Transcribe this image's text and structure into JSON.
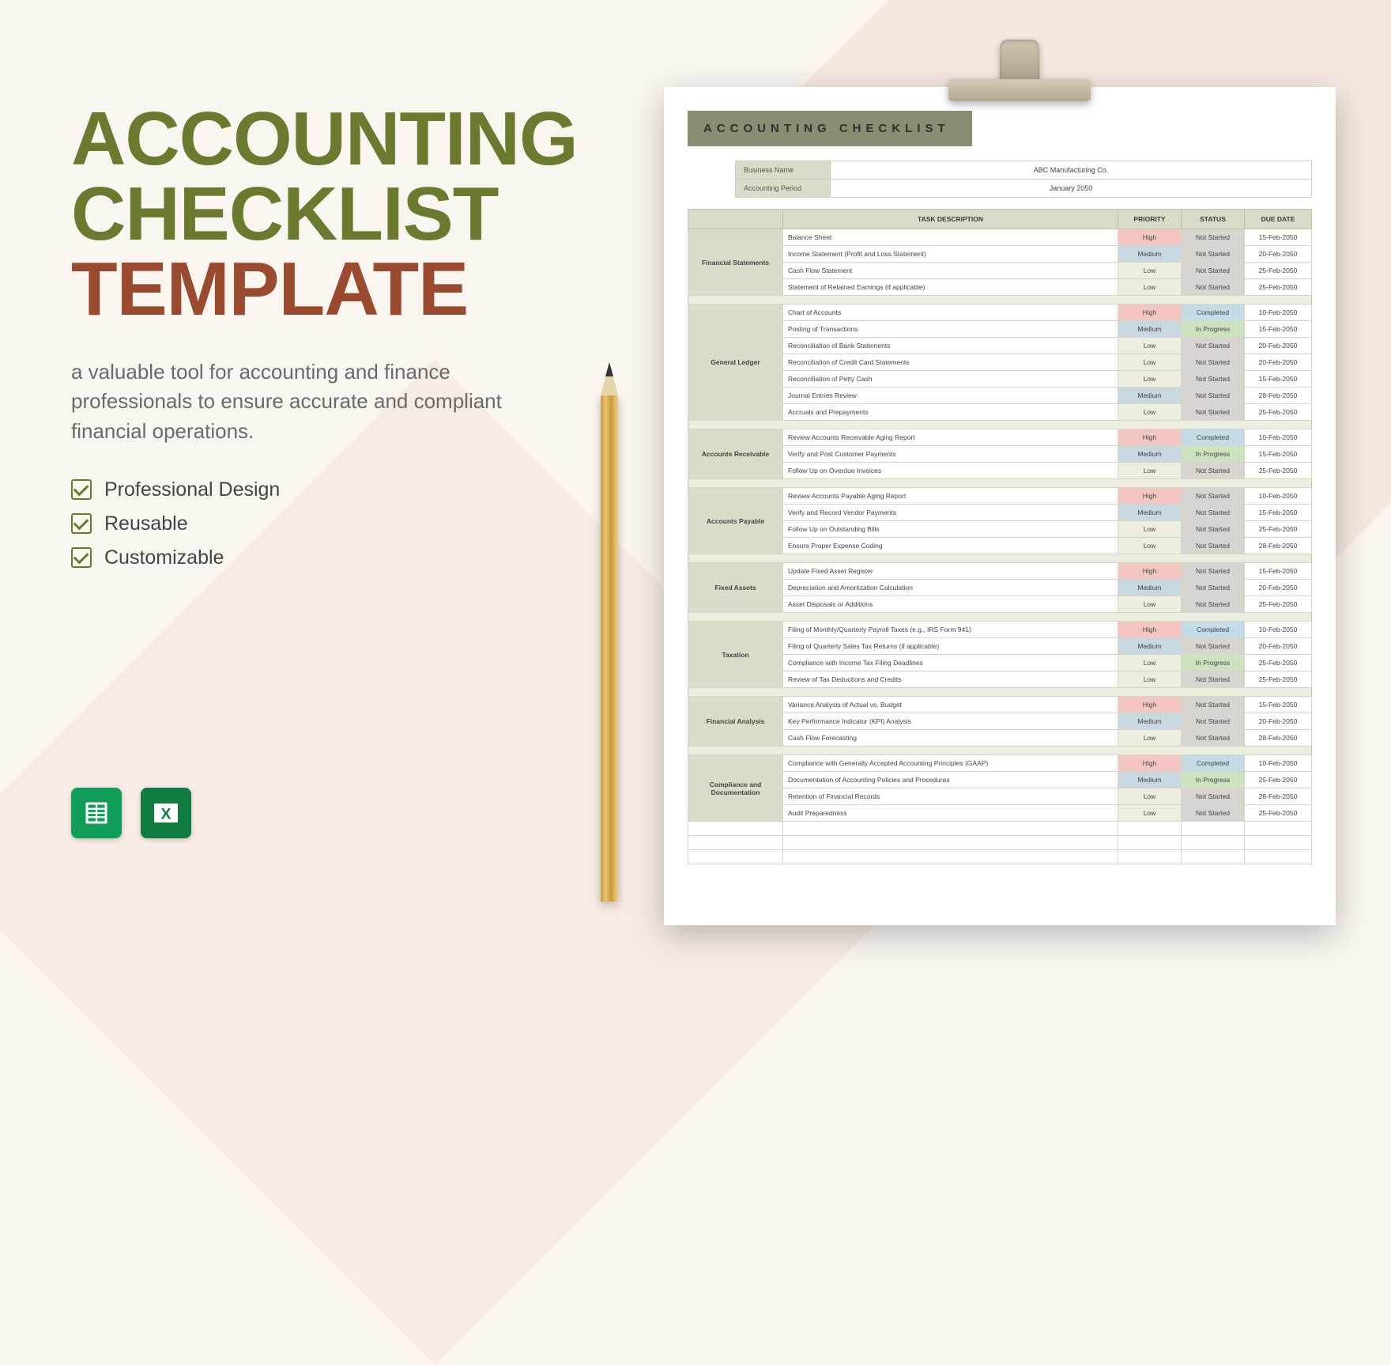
{
  "title": {
    "line1": "ACCOUNTING",
    "line2": "CHECKLIST",
    "line3": "TEMPLATE"
  },
  "description": "a valuable tool for accounting and finance professionals to ensure accurate and compliant financial operations.",
  "features": [
    "Professional Design",
    "Reusable",
    "Customizable"
  ],
  "apps": {
    "sheets": "Google Sheets",
    "excel": "Excel"
  },
  "sheet": {
    "heading": "ACCOUNTING CHECKLIST",
    "meta": [
      {
        "label": "Business Name",
        "value": "ABC Manufacturing Co."
      },
      {
        "label": "Accounting Period",
        "value": "January 2050"
      }
    ],
    "columns": [
      "TASK DESCRIPTION",
      "PRIORITY",
      "STATUS",
      "DUE DATE"
    ],
    "sections": [
      {
        "name": "Financial Statements",
        "rows": [
          {
            "task": "Balance Sheet",
            "priority": "High",
            "status": "Not Started",
            "due": "15-Feb-2050"
          },
          {
            "task": "Income Statement (Profit and Loss Statement)",
            "priority": "Medium",
            "status": "Not Started",
            "due": "20-Feb-2050"
          },
          {
            "task": "Cash Flow Statement",
            "priority": "Low",
            "status": "Not Started",
            "due": "25-Feb-2050"
          },
          {
            "task": "Statement of Retained Earnings (if applicable)",
            "priority": "Low",
            "status": "Not Started",
            "due": "25-Feb-2050"
          }
        ]
      },
      {
        "name": "General Ledger",
        "rows": [
          {
            "task": "Chart of Accounts",
            "priority": "High",
            "status": "Completed",
            "due": "10-Feb-2050"
          },
          {
            "task": "Posting of Transactions",
            "priority": "Medium",
            "status": "In Progress",
            "due": "15-Feb-2050"
          },
          {
            "task": "Reconciliation of Bank Statements",
            "priority": "Low",
            "status": "Not Started",
            "due": "20-Feb-2050"
          },
          {
            "task": "Reconciliation of Credit Card Statements",
            "priority": "Low",
            "status": "Not Started",
            "due": "20-Feb-2050"
          },
          {
            "task": "Reconciliation of Petty Cash",
            "priority": "Low",
            "status": "Not Started",
            "due": "15-Feb-2050"
          },
          {
            "task": "Journal Entries Review",
            "priority": "Medium",
            "status": "Not Started",
            "due": "28-Feb-2050"
          },
          {
            "task": "Accruals and Prepayments",
            "priority": "Low",
            "status": "Not Started",
            "due": "25-Feb-2050"
          }
        ]
      },
      {
        "name": "Accounts Receivable",
        "rows": [
          {
            "task": "Review Accounts Receivable Aging Report",
            "priority": "High",
            "status": "Completed",
            "due": "10-Feb-2050"
          },
          {
            "task": "Verify and Post Customer Payments",
            "priority": "Medium",
            "status": "In Progress",
            "due": "15-Feb-2050"
          },
          {
            "task": "Follow Up on Overdue Invoices",
            "priority": "Low",
            "status": "Not Started",
            "due": "25-Feb-2050"
          }
        ]
      },
      {
        "name": "Accounts Payable",
        "rows": [
          {
            "task": "Review Accounts Payable Aging Report",
            "priority": "High",
            "status": "Not Started",
            "due": "10-Feb-2050"
          },
          {
            "task": "Verify and Record Vendor Payments",
            "priority": "Medium",
            "status": "Not Started",
            "due": "15-Feb-2050"
          },
          {
            "task": "Follow Up on Outstanding Bills",
            "priority": "Low",
            "status": "Not Started",
            "due": "25-Feb-2050"
          },
          {
            "task": "Ensure Proper Expense Coding",
            "priority": "Low",
            "status": "Not Started",
            "due": "28-Feb-2050"
          }
        ]
      },
      {
        "name": "Fixed Assets",
        "rows": [
          {
            "task": "Update Fixed Asset Register",
            "priority": "High",
            "status": "Not Started",
            "due": "15-Feb-2050"
          },
          {
            "task": "Depreciation and Amortization Calculation",
            "priority": "Medium",
            "status": "Not Started",
            "due": "20-Feb-2050"
          },
          {
            "task": "Asset Disposals or Additions",
            "priority": "Low",
            "status": "Not Started",
            "due": "25-Feb-2050"
          }
        ]
      },
      {
        "name": "Taxation",
        "rows": [
          {
            "task": "Filing of Monthly/Quarterly Payroll Taxes (e.g., IRS Form 941)",
            "priority": "High",
            "status": "Completed",
            "due": "10-Feb-2050"
          },
          {
            "task": "Filing of Quarterly Sales Tax Returns (if applicable)",
            "priority": "Medium",
            "status": "Not Started",
            "due": "20-Feb-2050"
          },
          {
            "task": "Compliance with Income Tax Filing Deadlines",
            "priority": "Low",
            "status": "In Progress",
            "due": "25-Feb-2050"
          },
          {
            "task": "Review of Tax Deductions and Credits",
            "priority": "Low",
            "status": "Not Started",
            "due": "25-Feb-2050"
          }
        ]
      },
      {
        "name": "Financial Analysis",
        "rows": [
          {
            "task": "Variance Analysis of Actual vs. Budget",
            "priority": "High",
            "status": "Not Started",
            "due": "15-Feb-2050"
          },
          {
            "task": "Key Performance Indicator (KPI) Analysis",
            "priority": "Medium",
            "status": "Not Started",
            "due": "20-Feb-2050"
          },
          {
            "task": "Cash Flow Forecasting",
            "priority": "Low",
            "status": "Not Started",
            "due": "28-Feb-2050"
          }
        ]
      },
      {
        "name": "Compliance and Documentation",
        "rows": [
          {
            "task": "Compliance with Generally Accepted Accounting Principles (GAAP)",
            "priority": "High",
            "status": "Completed",
            "due": "10-Feb-2050"
          },
          {
            "task": "Documentation of Accounting Policies and Procedures",
            "priority": "Medium",
            "status": "In Progress",
            "due": "25-Feb-2050"
          },
          {
            "task": "Retention of Financial Records",
            "priority": "Low",
            "status": "Not Started",
            "due": "28-Feb-2050"
          },
          {
            "task": "Audit Preparedness",
            "priority": "Low",
            "status": "Not Started",
            "due": "25-Feb-2050"
          }
        ]
      }
    ]
  }
}
